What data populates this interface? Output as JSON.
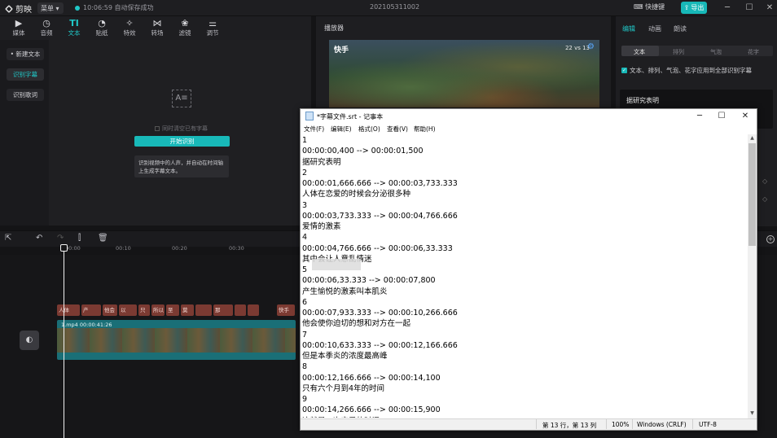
{
  "app": {
    "name": "剪映",
    "menu_label": "菜单",
    "save_status": "10:06:59 自动保存成功",
    "project_title": "202105311002",
    "shortcut_label": "快捷键",
    "export_label": "导出",
    "window_controls": [
      "minimize-icon",
      "maximize-icon",
      "close-icon"
    ]
  },
  "media_toolbar": {
    "items": [
      {
        "label": "媒体",
        "icon": "media-icon"
      },
      {
        "label": "音频",
        "icon": "audio-icon"
      },
      {
        "label": "文本",
        "icon": "text-icon",
        "active": true
      },
      {
        "label": "贴纸",
        "icon": "sticker-icon"
      },
      {
        "label": "特效",
        "icon": "effects-icon"
      },
      {
        "label": "转场",
        "icon": "transition-icon"
      },
      {
        "label": "滤镜",
        "icon": "filter-icon"
      },
      {
        "label": "调节",
        "icon": "adjust-icon"
      }
    ]
  },
  "text_sidebar": {
    "items": [
      {
        "label": "• 新建文本"
      },
      {
        "label": "识别字幕",
        "active": true
      },
      {
        "label": "识别歌词"
      }
    ]
  },
  "text_main": {
    "clear_label": "同时清空已有字幕",
    "start_button": "开始识别",
    "hint": "识别视频中的人声，并自动在时间轴上生成字幕文本。"
  },
  "player": {
    "title": "播放器",
    "overlay_logo": "快手",
    "overlay_hud": "22 vs 13"
  },
  "inspector": {
    "tabs": [
      {
        "label": "编辑",
        "active": true
      },
      {
        "label": "动画"
      },
      {
        "label": "朗读"
      }
    ],
    "subtabs": [
      {
        "label": "文本",
        "active": true
      },
      {
        "label": "排列"
      },
      {
        "label": "气泡"
      },
      {
        "label": "花字"
      }
    ],
    "apply_all_label": "文本、排列、气泡、花字应用到全部识别字幕",
    "caption_text": "据研究表明"
  },
  "timeline": {
    "ticks": [
      "00:00",
      "00:10",
      "00:20",
      "00:30"
    ],
    "video_clip_label": "1.mp4   00:00:41:26",
    "subtitle_clips": [
      "人体",
      "产",
      "他会",
      "以",
      "只",
      "所以",
      "至",
      "莫",
      "",
      "那",
      "",
      "",
      "快手"
    ]
  },
  "notepad": {
    "title": "*字幕文件.srt - 记事本",
    "menus": [
      "文件(F)",
      "编辑(E)",
      "格式(O)",
      "查看(V)",
      "帮助(H)"
    ],
    "lines": [
      "1",
      "00:00:00,400 --> 00:00:01,500",
      "据研究表明",
      "2",
      "00:00:01,666.666 --> 00:00:03,733.333",
      "人体在恋爱的时候会分泌很多种",
      "3",
      "00:00:03,733.333 --> 00:00:04,766.666",
      "爱情的激素",
      "4",
      "00:00:04,766.666 --> 00:00:06,33.333",
      "其中会让人意乱情迷",
      "5",
      "00:00:06,33.333 --> 00:00:07,800",
      "产生愉悦的激素叫本肌炎",
      "6",
      "00:00:07,933.333 --> 00:00:10,266.666",
      "他会使你迫切的想和对方在一起",
      "7",
      "00:00:10,633.333 --> 00:00:12,166.666",
      "但是本季炎的浓度最高峰",
      "8",
      "00:00:12,166.666 --> 00:00:14,100",
      "只有六个月到4年的时间",
      "9",
      "00:00:14,266.666 --> 00:00:15,900",
      "这就是一次恋爱的时间"
    ],
    "status": {
      "position": "第 13 行，第 13 列",
      "zoom": "100%",
      "line_ending": "Windows (CRLF)",
      "encoding": "UTF-8"
    }
  }
}
